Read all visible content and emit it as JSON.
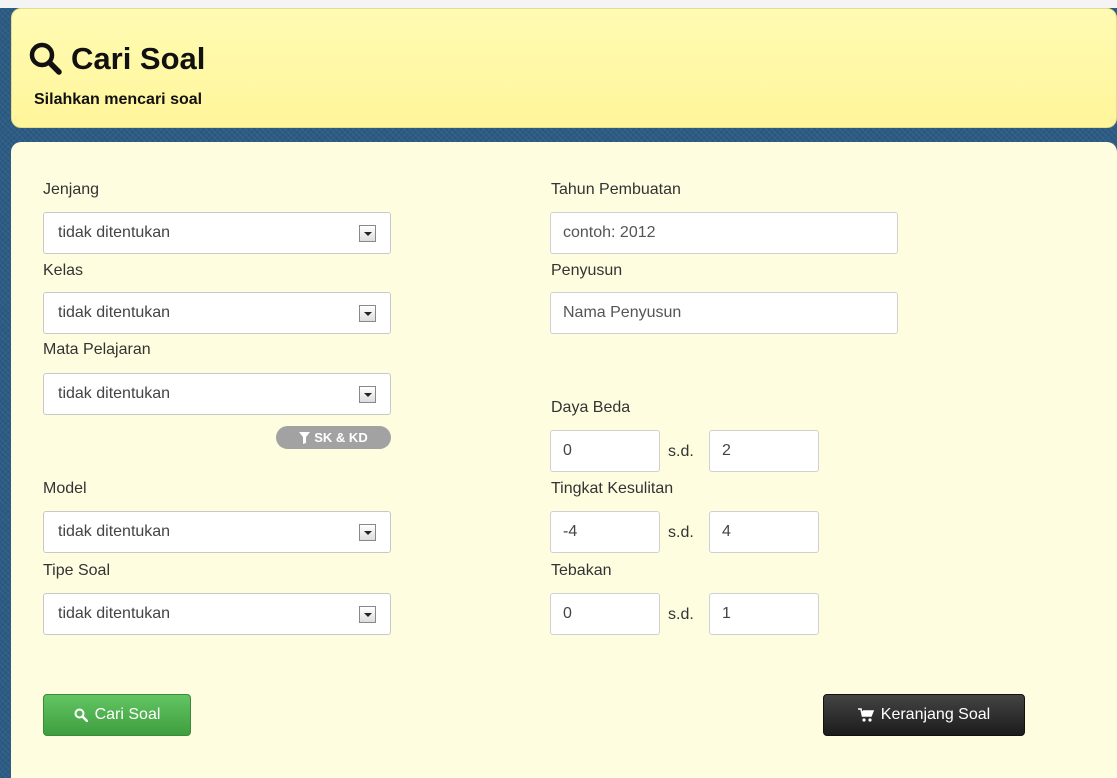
{
  "header": {
    "title": "Cari Soal",
    "subtitle": "Silahkan mencari soal",
    "icon": "search-icon"
  },
  "left_fields": [
    {
      "label": "Jenjang",
      "value": "tidak ditentukan"
    },
    {
      "label": "Kelas",
      "value": "tidak ditentukan"
    },
    {
      "label": "Mata Pelajaran",
      "value": "tidak ditentukan"
    },
    {
      "label": "Model",
      "value": "tidak ditentukan"
    },
    {
      "label": "Tipe Soal",
      "value": "tidak ditentukan"
    }
  ],
  "filter_pill": {
    "label": "SK & KD",
    "icon": "filter-icon"
  },
  "right_fields": {
    "tahun": {
      "label": "Tahun Pembuatan",
      "placeholder": "contoh: 2012"
    },
    "penyusun": {
      "label": "Penyusun",
      "placeholder": "Nama Penyusun"
    }
  },
  "ranges": {
    "separator": "s.d.",
    "daya_beda": {
      "label": "Daya Beda",
      "from": "0",
      "to": "2"
    },
    "tingkat_kesulitan": {
      "label": "Tingkat Kesulitan",
      "from": "-4",
      "to": "4"
    },
    "tebakan": {
      "label": "Tebakan",
      "from": "0",
      "to": "1"
    }
  },
  "buttons": {
    "search": {
      "label": "Cari Soal",
      "icon": "search-icon"
    },
    "cart": {
      "label": "Keranjang Soal",
      "icon": "cart-icon"
    }
  },
  "colors": {
    "header_bg": "#fff59a",
    "panel_bg": "#fffde0",
    "search_button": "#4cae4c",
    "cart_button": "#222222",
    "pill": "#a2a2a2"
  }
}
